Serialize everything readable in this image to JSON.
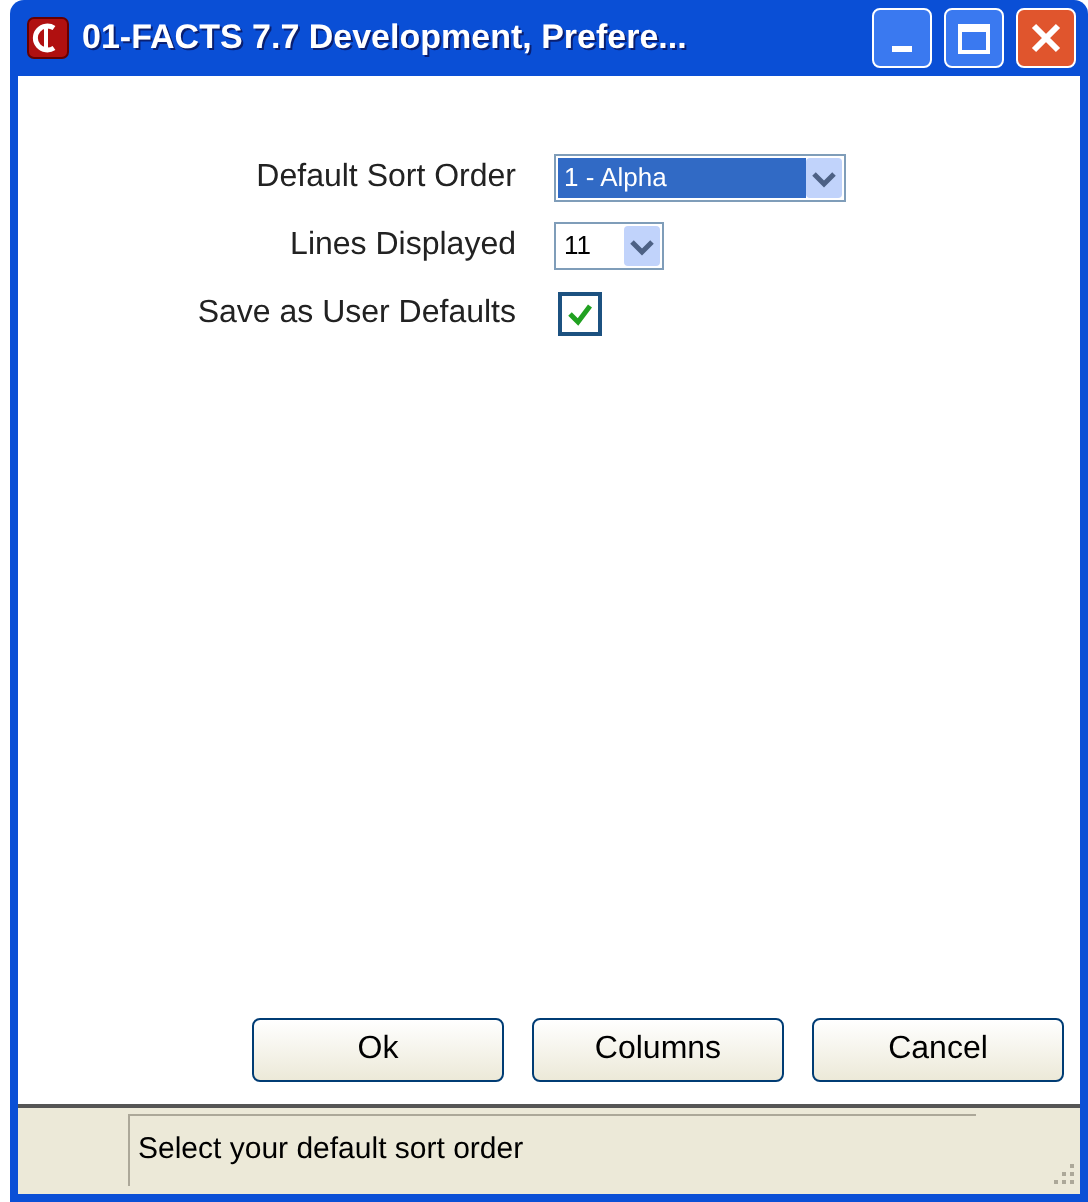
{
  "window": {
    "title": "01-FACTS 7.7 Development, Prefere..."
  },
  "fields": [
    {
      "kind": "dropdown",
      "label": "Default Sort Order",
      "value": "1 - Alpha",
      "focused": true
    },
    {
      "kind": "dropdown",
      "label": "Lines Displayed",
      "value": "11",
      "focused": false
    },
    {
      "kind": "checkbox",
      "label": "Save as User Defaults",
      "checked": true
    }
  ],
  "buttons": [
    "Ok",
    "Columns",
    "Cancel"
  ],
  "status_bar": {
    "text": "Select your default sort order"
  }
}
